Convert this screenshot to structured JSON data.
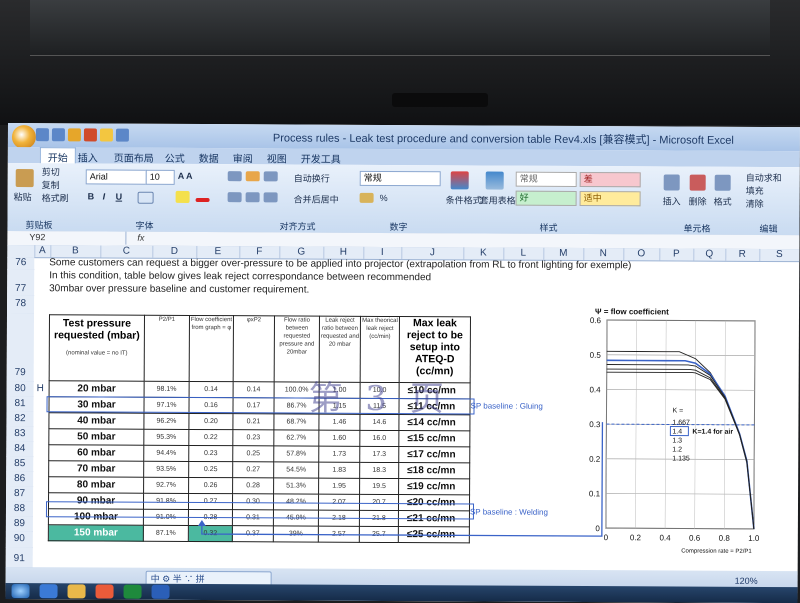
{
  "window": {
    "title": "Process rules - Leak test procedure and conversion table Rev4.xls  [兼容模式] - Microsoft Excel"
  },
  "ribbon_tabs": [
    "开始",
    "插入",
    "页面布局",
    "公式",
    "数据",
    "审阅",
    "视图",
    "开发工具"
  ],
  "ribbon": {
    "clipboard": {
      "paste": "粘贴",
      "cut": "剪切",
      "copy": "复制",
      "format_painter": "格式刷",
      "group": "剪贴板"
    },
    "font": {
      "name": "Arial",
      "size": "10",
      "group": "字体"
    },
    "alignment": {
      "wrap": "自动换行",
      "merge": "合并后居中",
      "group": "对齐方式"
    },
    "number": {
      "format": "常规",
      "group": "数字"
    },
    "styles": {
      "cond_format": "条件格式",
      "table_format": "套用表格格式",
      "normal": "常规",
      "bad": "差",
      "good": "好",
      "neutral": "适中",
      "group": "样式"
    },
    "cells": {
      "insert": "插入",
      "delete": "删除",
      "format": "格式",
      "group": "单元格"
    },
    "editing": {
      "autosum": "自动求和",
      "fill": "填充",
      "clear": "清除",
      "group": "编辑"
    }
  },
  "formula_bar": {
    "cell": "Y92",
    "fx": "fx",
    "content": ""
  },
  "columns": [
    "A",
    "B",
    "C",
    "D",
    "E",
    "F",
    "G",
    "H",
    "I",
    "J",
    "K",
    "L",
    "M",
    "N",
    "O",
    "P",
    "Q",
    "R",
    "S"
  ],
  "rows": [
    "76",
    "77",
    "78",
    "79",
    "80",
    "81",
    "82",
    "83",
    "84",
    "85",
    "86",
    "87",
    "88",
    "89",
    "90",
    "91"
  ],
  "row80_marker": "H",
  "notes": {
    "line1": "Some customers can request a bigger over-pressure to be applied into projector  (extrapolation from RL to front lighting for exemple)",
    "line2": "In this condition, table below gives leak reject correspondance between recommended",
    "line3": "30mbar over pressure baseline and customer requirement."
  },
  "table": {
    "headers": {
      "test_pressure": "Test pressure requested (mbar)",
      "nominal": "(nominal value = no IT)",
      "p2p1": "P2/P1",
      "flow_coeff": "Flow coefficient from graph = φ",
      "phi_p2": "φxP2",
      "flow_ratio": "Flow ratio between requested pressure and 20mbar",
      "leak_ratio": "Leak reject ratio between requested and 20 mbar",
      "max_theo": "Max theorical leak reject (cc/min)",
      "max_leak": "Max leak reject to be setup into ATEQ-D (cc/mn)"
    },
    "rows": [
      {
        "pressure": "20 mbar",
        "p2p1": "98.1%",
        "flow": "0.14",
        "phixp2": "0.14",
        "flow_ratio": "100.0%",
        "leak_ratio": "1.00",
        "max_theo": "10.0",
        "max_leak": "≤10 cc/mn"
      },
      {
        "pressure": "30 mbar",
        "p2p1": "97.1%",
        "flow": "0.16",
        "phixp2": "0.17",
        "flow_ratio": "86.7%",
        "leak_ratio": "1.15",
        "max_theo": "11.5",
        "max_leak": "≤11 cc/mn"
      },
      {
        "pressure": "40 mbar",
        "p2p1": "96.2%",
        "flow": "0.20",
        "phixp2": "0.21",
        "flow_ratio": "68.7%",
        "leak_ratio": "1.46",
        "max_theo": "14.6",
        "max_leak": "≤14 cc/mn"
      },
      {
        "pressure": "50 mbar",
        "p2p1": "95.3%",
        "flow": "0.22",
        "phixp2": "0.23",
        "flow_ratio": "62.7%",
        "leak_ratio": "1.60",
        "max_theo": "16.0",
        "max_leak": "≤15 cc/mn"
      },
      {
        "pressure": "60 mbar",
        "p2p1": "94.4%",
        "flow": "0.23",
        "phixp2": "0.25",
        "flow_ratio": "57.8%",
        "leak_ratio": "1.73",
        "max_theo": "17.3",
        "max_leak": "≤17 cc/mn"
      },
      {
        "pressure": "70 mbar",
        "p2p1": "93.5%",
        "flow": "0.25",
        "phixp2": "0.27",
        "flow_ratio": "54.5%",
        "leak_ratio": "1.83",
        "max_theo": "18.3",
        "max_leak": "≤18 cc/mn"
      },
      {
        "pressure": "80 mbar",
        "p2p1": "92.7%",
        "flow": "0.26",
        "phixp2": "0.28",
        "flow_ratio": "51.3%",
        "leak_ratio": "1.95",
        "max_theo": "19.5",
        "max_leak": "≤19 cc/mn"
      },
      {
        "pressure": "90 mbar",
        "p2p1": "91.8%",
        "flow": "0.27",
        "phixp2": "0.30",
        "flow_ratio": "48.2%",
        "leak_ratio": "2.07",
        "max_theo": "20.7",
        "max_leak": "≤20 cc/mn"
      },
      {
        "pressure": "100 mbar",
        "p2p1": "91.0%",
        "flow": "0.28",
        "phixp2": "0.31",
        "flow_ratio": "45.9%",
        "leak_ratio": "2.18",
        "max_theo": "21.8",
        "max_leak": "≤21 cc/mn"
      },
      {
        "pressure": "150 mbar",
        "p2p1": "87.1%",
        "flow": "0.32",
        "phixp2": "0.37",
        "flow_ratio": "39%",
        "leak_ratio": "2.57",
        "max_theo": "25.7",
        "max_leak": "≤25 cc/mn"
      }
    ]
  },
  "annotations": {
    "gluing": "SP baseline : Gluing",
    "welding": "SP baseline : Welding",
    "watermark": "第 3 页"
  },
  "colors": {
    "highlight_box": "#3a63c8",
    "teal_fill": "#4bb9a0"
  },
  "chart_data": {
    "type": "line",
    "title": "Ψ = flow coefficient",
    "xlabel": "Compression rate = P2/P1",
    "xlim": [
      0,
      1.0
    ],
    "ylim": [
      0,
      0.6
    ],
    "x_ticks": [
      "0",
      "0.2",
      "0.4",
      "0.6",
      "0.8",
      "1.0"
    ],
    "y_ticks": [
      "0",
      "0.1",
      "0.2",
      "0.3",
      "0.4",
      "0.5",
      "0.6"
    ],
    "legend_title": "K =",
    "legend_items": [
      "1.667",
      "1.4",
      "1.3",
      "1.2",
      "1.135"
    ],
    "highlight_label": "K=1.4 for air",
    "series": [
      {
        "name": "1.667",
        "x": [
          0,
          0.2,
          0.4,
          0.49,
          0.6,
          0.7,
          0.8,
          0.9,
          0.95,
          1.0
        ],
        "values": [
          0.51,
          0.51,
          0.51,
          0.51,
          0.49,
          0.45,
          0.38,
          0.27,
          0.19,
          0
        ]
      },
      {
        "name": "1.4",
        "x": [
          0,
          0.2,
          0.4,
          0.53,
          0.6,
          0.7,
          0.8,
          0.9,
          0.95,
          1.0
        ],
        "values": [
          0.484,
          0.484,
          0.484,
          0.484,
          0.477,
          0.446,
          0.383,
          0.274,
          0.196,
          0
        ]
      },
      {
        "name": "1.3",
        "x": [
          0,
          0.2,
          0.4,
          0.55,
          0.6,
          0.7,
          0.8,
          0.9,
          0.95,
          1.0
        ],
        "values": [
          0.472,
          0.472,
          0.472,
          0.472,
          0.469,
          0.442,
          0.38,
          0.273,
          0.195,
          0
        ]
      },
      {
        "name": "1.2",
        "x": [
          0,
          0.2,
          0.4,
          0.56,
          0.6,
          0.7,
          0.8,
          0.9,
          0.95,
          1.0
        ],
        "values": [
          0.459,
          0.459,
          0.459,
          0.459,
          0.457,
          0.435,
          0.377,
          0.272,
          0.194,
          0
        ]
      },
      {
        "name": "1.135",
        "x": [
          0,
          0.2,
          0.4,
          0.58,
          0.6,
          0.7,
          0.8,
          0.9,
          0.95,
          1.0
        ],
        "values": [
          0.45,
          0.45,
          0.45,
          0.45,
          0.449,
          0.43,
          0.374,
          0.271,
          0.194,
          0
        ]
      }
    ],
    "reference_line_y": 0.3
  },
  "status": {
    "zoom": "120%"
  },
  "ime": "中 ⚙ 半 ∵ 拼"
}
